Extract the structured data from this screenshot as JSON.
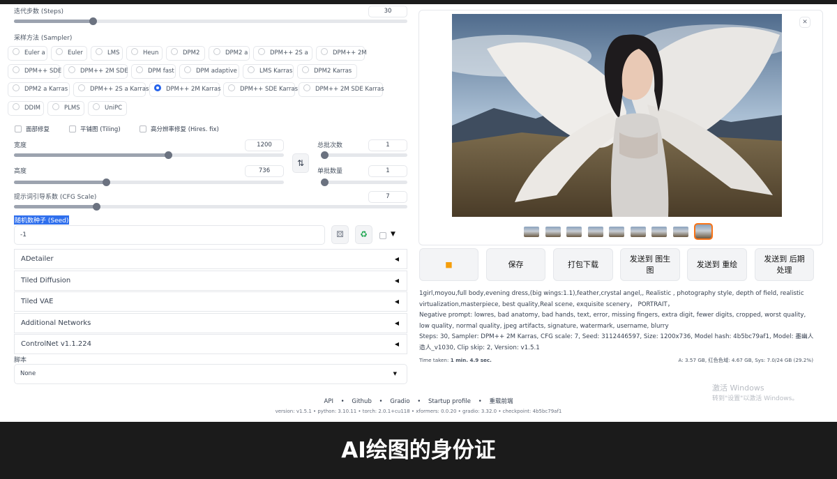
{
  "left": {
    "steps": {
      "label": "迭代步数 (Steps)",
      "value": "30",
      "fraction": 0.2
    },
    "sampler": {
      "label": "采样方法 (Sampler)",
      "options": [
        "Euler a",
        "Euler",
        "LMS",
        "Heun",
        "DPM2",
        "DPM2 a",
        "DPM++ 2S a",
        "DPM++ 2M",
        "DPM++ SDE",
        "DPM++ 2M SDE",
        "DPM fast",
        "DPM adaptive",
        "LMS Karras",
        "DPM2 Karras",
        "DPM2 a Karras",
        "DPM++ 2S a Karras",
        "DPM++ 2M Karras",
        "DPM++ SDE Karras",
        "DPM++ 2M SDE Karras",
        "DDIM",
        "PLMS",
        "UniPC"
      ],
      "selected": "DPM++ 2M Karras"
    },
    "checkboxes": [
      "面部修复",
      "平铺图 (Tiling)",
      "高分辨率修复 (Hires. fix)"
    ],
    "width": {
      "label": "宽度",
      "value": "1200",
      "fraction": 0.57
    },
    "height": {
      "label": "高度",
      "value": "736",
      "fraction": 0.34
    },
    "batch_count": {
      "label": "总批次数",
      "value": "1",
      "fraction": 0.0
    },
    "batch_size": {
      "label": "单批数量",
      "value": "1",
      "fraction": 0.0
    },
    "cfg": {
      "label": "提示词引导系数 (CFG Scale)",
      "value": "7",
      "fraction": 0.2
    },
    "seed": {
      "label": "随机数种子 (Seed)",
      "value": "-1"
    },
    "accordions": [
      "ADetailer",
      "Tiled Diffusion",
      "Tiled VAE",
      "Additional Networks",
      "ControlNet v1.1.224"
    ],
    "script": {
      "label": "脚本",
      "value": "None"
    }
  },
  "right": {
    "action_buttons": [
      "保存",
      "打包下载",
      "发送到 图生图",
      "发送到 重绘",
      "发送到 后期处理"
    ],
    "folder_icon": "folder-icon",
    "thumbnail_count": 9,
    "info": {
      "prompt": "1girl,moyou,full body,evening dress,(big wings:1.1),feather,crystal angel,, Realistic , photography style, depth of field, realistic virtualization,masterpiece, best quality,Real scene, exquisite scenery， PORTRAIT，",
      "negative": "Negative prompt: lowres, bad anatomy, bad hands, text, error, missing fingers, extra digit, fewer digits, cropped, worst quality, low quality, normal quality, jpeg artifacts, signature, watermark, username, blurry",
      "params": "Steps: 30, Sampler: DPM++ 2M Karras, CFG scale: 7, Seed: 3112446597, Size: 1200x736, Model hash: 4b5bc79af1, Model: 墨幽人造人_v1030, Clip skip: 2, Version: v1.5.1",
      "time_prefix": "Time taken: ",
      "time_value": "1 min. 4.9 sec.",
      "memory": "A: 3.57 GB, 红色色域: 4.67 GB, Sys: 7.0/24 GB (29.2%)"
    }
  },
  "footer": {
    "links": [
      "API",
      "Github",
      "Gradio",
      "Startup profile",
      "重载前端"
    ],
    "versions": "version: v1.5.1  •  python: 3.10.11  •  torch: 2.0.1+cu118  •  xformers: 0.0.20  •  gradio: 3.32.0  •  checkpoint: 4b5bc79af1"
  },
  "watermark": {
    "line1": "激活 Windows",
    "line2": "转到\"设置\"以激活 Windows。"
  },
  "caption": "AI绘图的身份证",
  "colors": {
    "accent": "#2563eb",
    "selected_thumb_border": "#f97316"
  }
}
